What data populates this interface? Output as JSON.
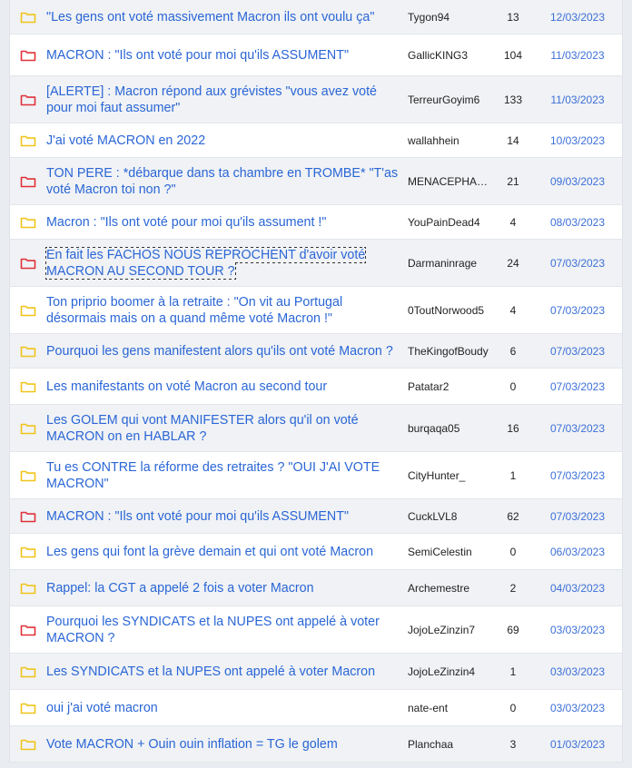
{
  "colors": {
    "folder_yellow": "#f0c419",
    "folder_red": "#e0313a",
    "link_blue": "#2a66d6",
    "date_blue": "#3c6fd8"
  },
  "topics": [
    {
      "icon": "folder-yellow-icon",
      "title": "\"Les gens ont voté massivement Macron ils ont voulu ça\"",
      "author": "Tygon94",
      "replies": "13",
      "date": "12/03/2023"
    },
    {
      "icon": "folder-red-icon",
      "title": "MACRON : \"Ils ont voté pour moi qu'ils ASSUMENT\"",
      "author": "GallicKING3",
      "replies": "104",
      "date": "11/03/2023"
    },
    {
      "icon": "folder-red-icon",
      "title": "[ALERTE] : Macron répond aux grévistes \"vous avez voté pour moi faut assumer\"",
      "author": "TerreurGoyim6",
      "replies": "133",
      "date": "11/03/2023"
    },
    {
      "icon": "folder-yellow-icon",
      "title": "J'ai voté MACRON en 2022",
      "author": "wallahhein",
      "replies": "14",
      "date": "10/03/2023"
    },
    {
      "icon": "folder-red-icon",
      "title": "TON PERE : *débarque dans ta chambre en TROMBE* \"T'as voté Macron toi non ?\"",
      "author": "MENACEPHAN…",
      "replies": "21",
      "date": "09/03/2023"
    },
    {
      "icon": "folder-yellow-icon",
      "title": "Macron : \"Ils ont voté pour moi qu'ils assument !\"",
      "author": "YouPainDead4",
      "replies": "4",
      "date": "08/03/2023"
    },
    {
      "icon": "folder-red-icon",
      "title": "En fait les FACHOS NOUS REPROCHENT d'avoir voté MACRON AU SECOND TOUR ?",
      "author": "Darmaninrage",
      "replies": "24",
      "date": "07/03/2023"
    },
    {
      "icon": "folder-yellow-icon",
      "title": "Ton priprio boomer à la retraite : \"On vit au Portugal désormais mais on a quand même voté Macron !\"",
      "author": "0ToutNorwood5",
      "replies": "4",
      "date": "07/03/2023"
    },
    {
      "icon": "folder-yellow-icon",
      "title": "Pourquoi les gens manifestent alors qu'ils ont voté Macron ?",
      "author": "TheKingofBoudy",
      "replies": "6",
      "date": "07/03/2023"
    },
    {
      "icon": "folder-yellow-icon",
      "title": "Les manifestants on voté Macron au second tour",
      "author": "Patatar2",
      "replies": "0",
      "date": "07/03/2023"
    },
    {
      "icon": "folder-yellow-icon",
      "title": "Les GOLEM qui vont MANIFESTER alors qu'il on voté MACRON on en HABLAR ?",
      "author": "burqaqa05",
      "replies": "16",
      "date": "07/03/2023"
    },
    {
      "icon": "folder-yellow-icon",
      "title": "Tu es CONTRE la réforme des retraites ? \"OUI J'AI VOTE MACRON\"",
      "author": "CityHunter_",
      "replies": "1",
      "date": "07/03/2023"
    },
    {
      "icon": "folder-red-icon",
      "title": "MACRON : \"Ils ont voté pour moi qu'ils ASSUMENT\"",
      "author": "CuckLVL8",
      "replies": "62",
      "date": "07/03/2023"
    },
    {
      "icon": "folder-yellow-icon",
      "title": "Les gens qui font la grève demain et qui ont voté Macron",
      "author": "SemiCelestin",
      "replies": "0",
      "date": "06/03/2023"
    },
    {
      "icon": "folder-yellow-icon",
      "title": "Rappel: la CGT a appelé 2 fois a voter Macron",
      "author": "Archemestre",
      "replies": "2",
      "date": "04/03/2023"
    },
    {
      "icon": "folder-red-icon",
      "title": "Pourquoi les SYNDICATS et la NUPES ont appelé à voter MACRON ?",
      "author": "JojoLeZinzin7",
      "replies": "69",
      "date": "03/03/2023"
    },
    {
      "icon": "folder-yellow-icon",
      "title": "Les SYNDICATS et la NUPES ont appelé à voter Macron",
      "author": "JojoLeZinzin4",
      "replies": "1",
      "date": "03/03/2023"
    },
    {
      "icon": "folder-yellow-icon",
      "title": "oui j'ai voté macron",
      "author": "nate-ent",
      "replies": "0",
      "date": "03/03/2023"
    },
    {
      "icon": "folder-yellow-icon",
      "title": "Vote MACRON + Ouin ouin inflation = TG le golem",
      "author": "Planchaa",
      "replies": "3",
      "date": "01/03/2023"
    }
  ]
}
